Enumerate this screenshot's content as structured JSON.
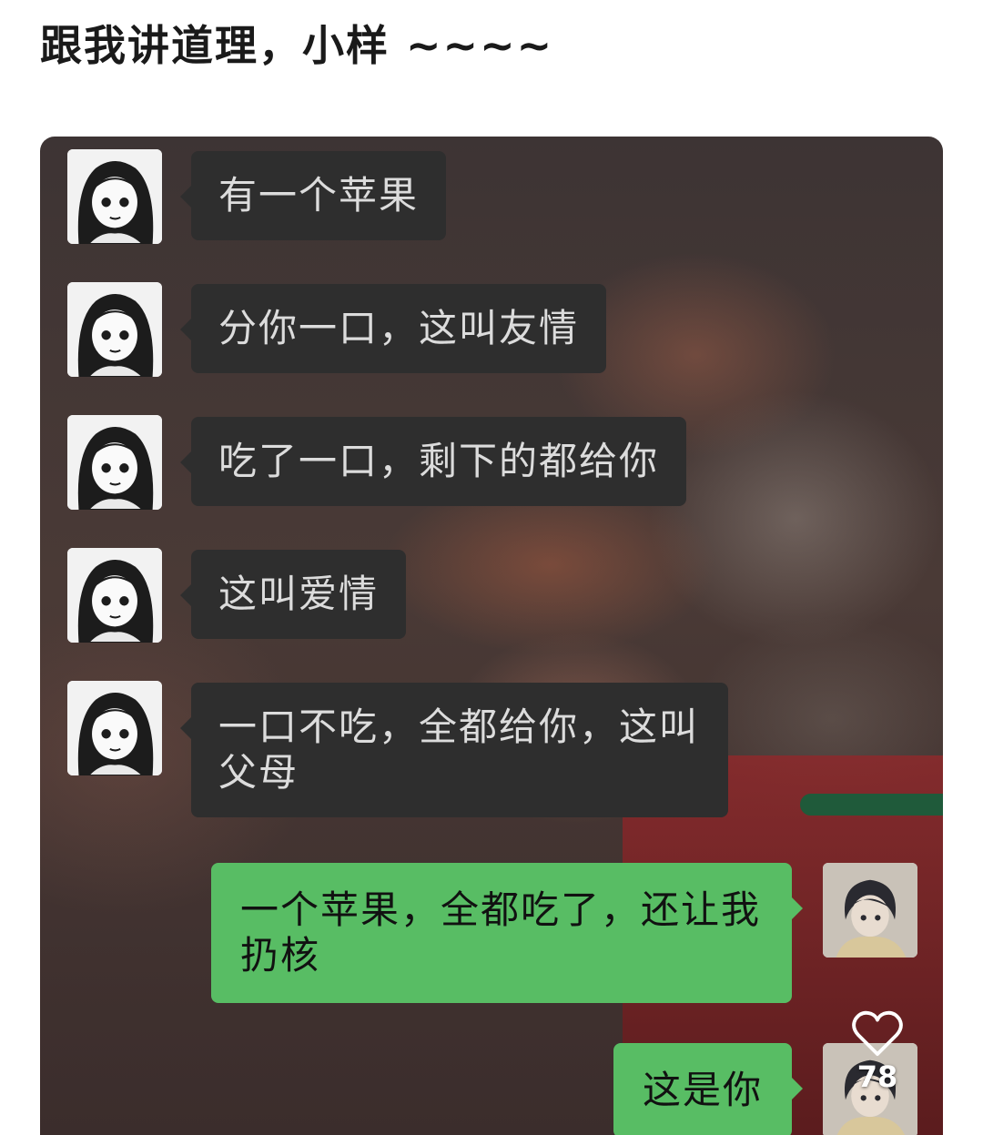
{
  "post": {
    "title": "跟我讲道理，小样 ~~~~"
  },
  "chat": {
    "messages": [
      {
        "sender": "other",
        "text": "有一个苹果"
      },
      {
        "sender": "other",
        "text": "分你一口，这叫友情"
      },
      {
        "sender": "other",
        "text": "吃了一口，剩下的都给你"
      },
      {
        "sender": "other",
        "text": "这叫爱情"
      },
      {
        "sender": "other",
        "text": "一口不吃，全都给你，这叫父母"
      },
      {
        "sender": "self",
        "text": "一个苹果，全都吃了，还让我扔核"
      },
      {
        "sender": "self",
        "text": "这是你"
      }
    ]
  },
  "like": {
    "count": "78",
    "icon": "heart-icon"
  },
  "colors": {
    "self_bubble": "#58bd64",
    "other_bubble": "#2e2e2e"
  }
}
